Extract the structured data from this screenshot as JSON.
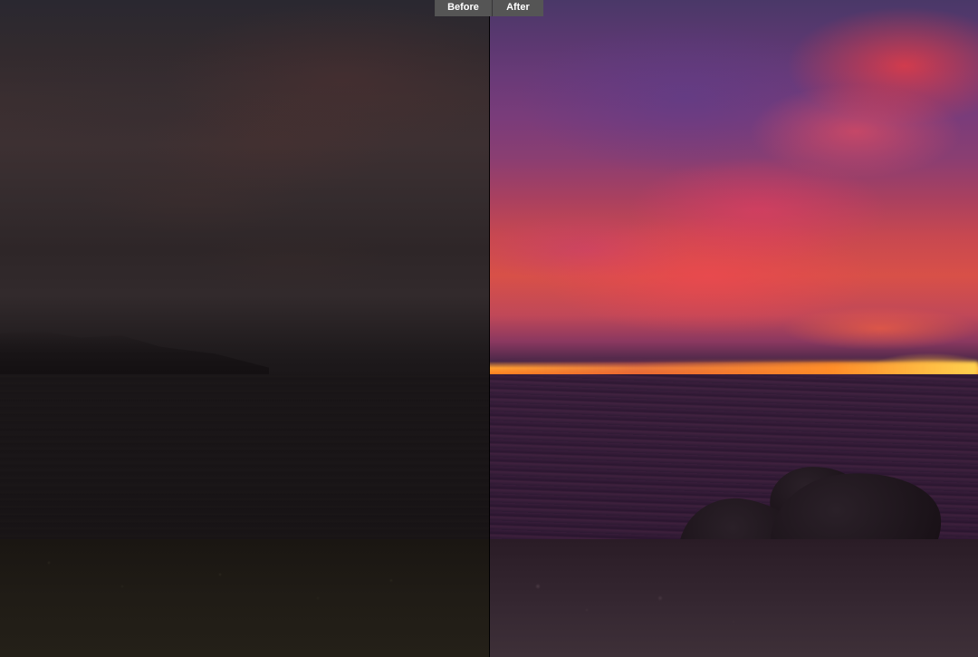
{
  "comparison": {
    "before_label": "Before",
    "after_label": "After"
  }
}
